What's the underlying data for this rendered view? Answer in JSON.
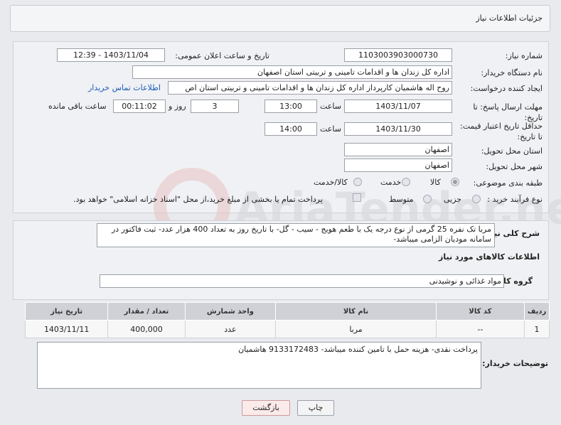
{
  "header": {
    "title": "جزئیات اطلاعات نیاز"
  },
  "fields": {
    "need_number_label": "شماره نیاز:",
    "need_number": "1103003903000730",
    "announce_label": "تاریخ و ساعت اعلان عمومی:",
    "announce_value": "1403/11/04 - 12:39",
    "buyer_org_label": "نام دستگاه خریدار:",
    "buyer_org": "اداره کل زندان ها و اقدامات تامینی و تربیتی استان اصفهان",
    "creator_label": "ایجاد کننده درخواست:",
    "creator": "روح اله هاشمیان کارپرداز اداره کل زندان ها و اقدامات تامینی و تربیتی استان اص",
    "contact_link": "اطلاعات تماس خریدار",
    "deadline_label": "مهلت ارسال پاسخ: تا تاریخ:",
    "deadline_date": "1403/11/07",
    "time_word": "ساعت",
    "deadline_time": "13:00",
    "days_value": "3",
    "days_word": "روز و",
    "remaining_value": "00:11:02",
    "remaining_word": "ساعت باقی مانده",
    "validity_label": "حداقل تاریخ اعتبار قیمت: تا تاریخ:",
    "validity_date": "1403/11/30",
    "validity_time": "14:00",
    "province_label": "استان محل تحویل:",
    "province": "اصفهان",
    "city_label": "شهر محل تحویل:",
    "city": "اصفهان",
    "category_label": "طبقه بندی موضوعی:",
    "category_options": [
      "کالا",
      "خدمت",
      "کالا/خدمت"
    ],
    "process_label": "نوع فرآیند خرید :",
    "process_options": [
      "جزیی",
      "متوسط"
    ],
    "payment_note": "پرداخت تمام یا بخشی از مبلغ خرید،از محل \"اسناد خزانه اسلامی\" خواهد بود."
  },
  "description": {
    "label": "شرح کلی نیاز:",
    "text": "مربا تک نفره 25 گرمی از نوع درجه یک با طعم هویج - سیب - گل- با تاریخ روز به تعداد 400 هزار عدد- ثبت فاکتور در سامانه مودیان الزامی میباشد-"
  },
  "goods": {
    "section_title": "اطلاعات کالاهای مورد نیاز",
    "group_label": "گروه کالا:",
    "group_value": "مواد غذائی و نوشیدنی",
    "columns": [
      "ردیف",
      "کد کالا",
      "نام کالا",
      "واحد شمارش",
      "تعداد / مقدار",
      "تاریخ نیاز"
    ],
    "rows": [
      [
        "1",
        "--",
        "مربا",
        "عدد",
        "400,000",
        "1403/11/11"
      ]
    ]
  },
  "buyer_notes": {
    "label": "توضیحات خریدار:",
    "text": "پرداخت نقدی- هزینه حمل با تامین کننده میباشد- 9133172483 هاشمیان"
  },
  "buttons": {
    "print": "چاپ",
    "back": "بازگشت"
  },
  "watermark": "AriaTender.neT"
}
